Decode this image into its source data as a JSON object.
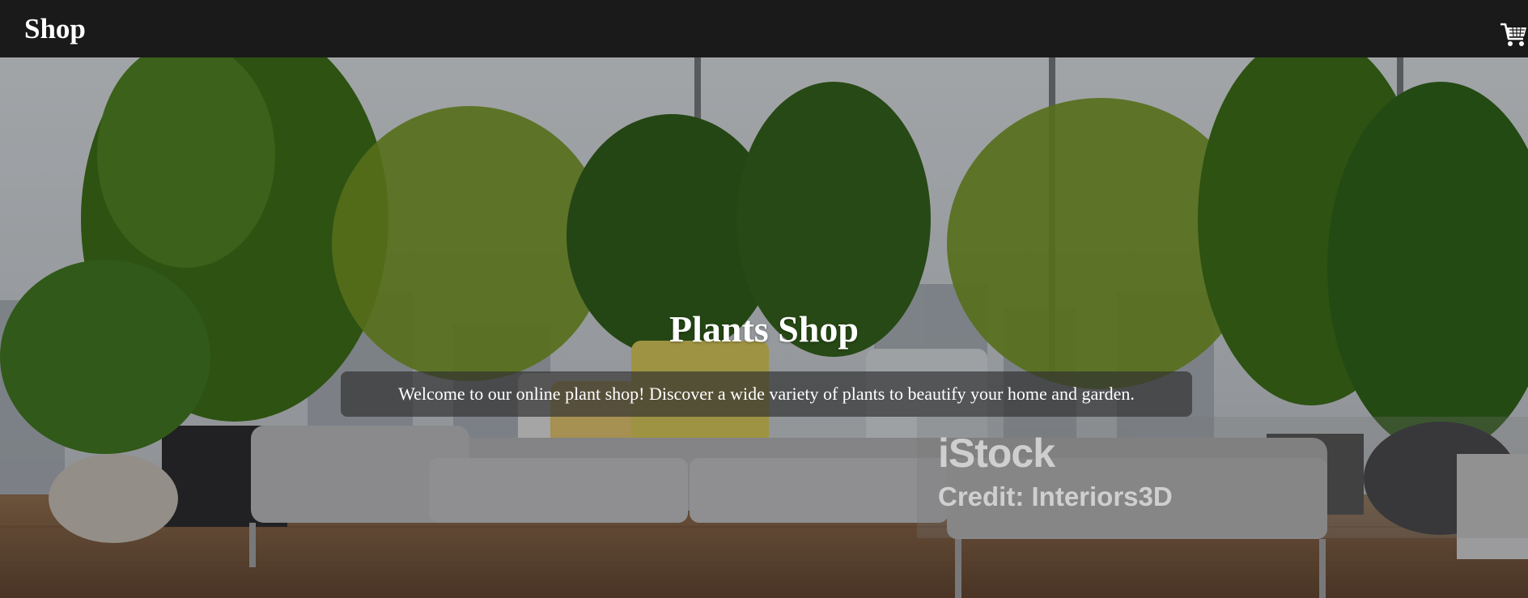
{
  "navbar": {
    "brand": "Shop",
    "cart_icon": "shopping-cart-icon",
    "background": "#1a1a1a"
  },
  "hero": {
    "title": "Plants Shop",
    "subtitle": "Welcome to our online plant shop! Discover a wide variety of plants to beautify your home and garden."
  },
  "watermark": {
    "logo": "iStock",
    "credit": "Credit: Interiors3D"
  },
  "colors": {
    "text": "#ffffff",
    "subtitle_box": "rgba(48,48,48,0.68)",
    "foliage": "#3f6b1c",
    "sofa": "#a9a9ac",
    "floor": "#7a5a3e"
  }
}
